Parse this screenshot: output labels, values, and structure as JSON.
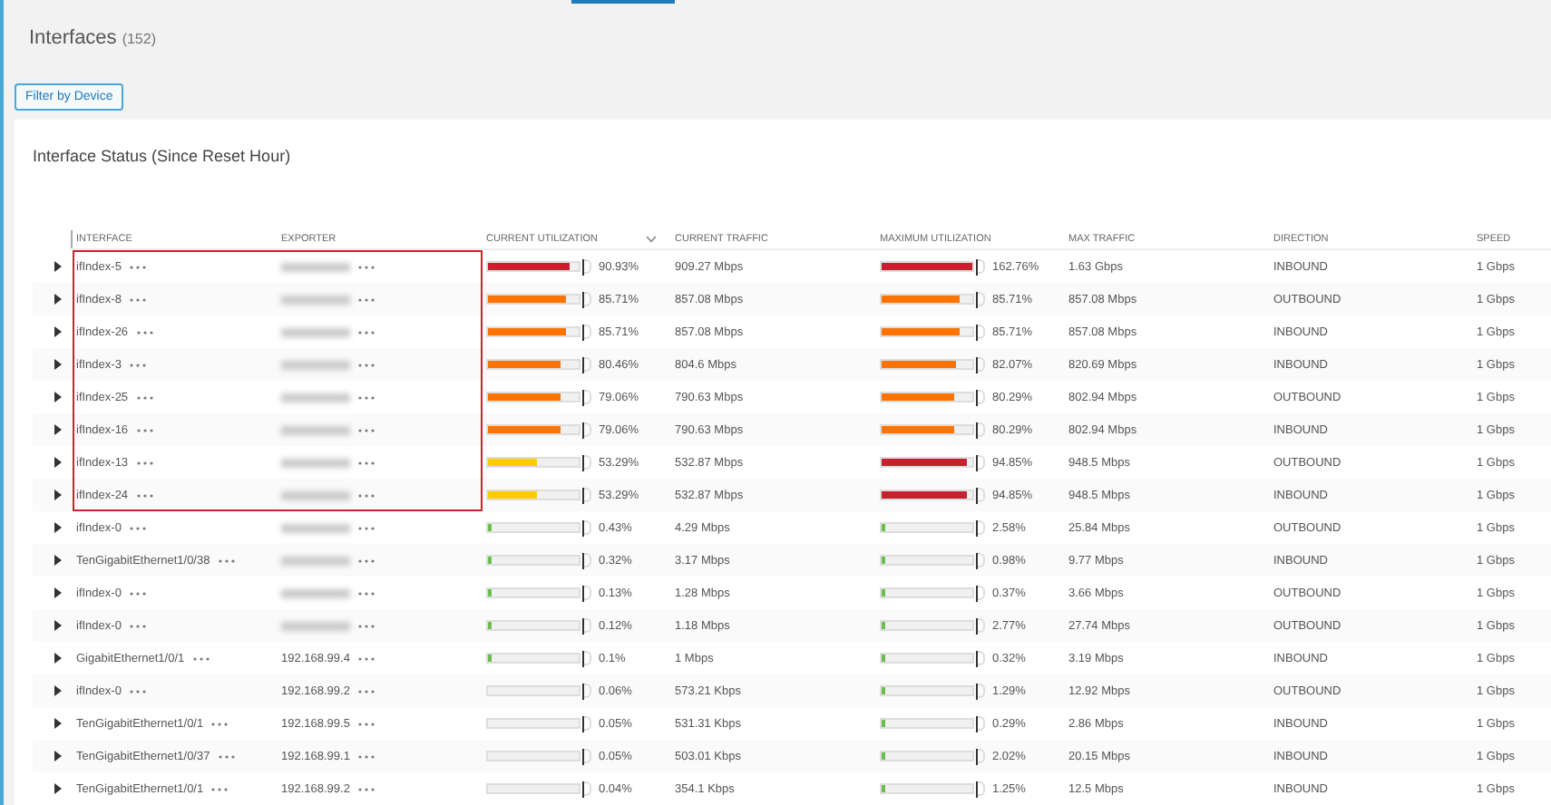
{
  "page": {
    "title": "Interfaces",
    "count": "(152)",
    "filter_button": "Filter by Device"
  },
  "card": {
    "title": "Interface Status (Since Reset Hour)"
  },
  "table": {
    "columns": [
      {
        "label": "INTERFACE",
        "sorted": false
      },
      {
        "label": "EXPORTER",
        "sorted": false
      },
      {
        "label": "CURRENT UTILIZATION",
        "sorted": true
      },
      {
        "label": "CURRENT TRAFFIC",
        "sorted": false
      },
      {
        "label": "MAXIMUM UTILIZATION",
        "sorted": false
      },
      {
        "label": "MAX TRAFFIC",
        "sorted": false
      },
      {
        "label": "DIRECTION",
        "sorted": false
      },
      {
        "label": "SPEED",
        "sorted": false
      }
    ],
    "rows": [
      {
        "interface": "ifIndex-5",
        "exporter_redacted": true,
        "highlighted": true,
        "current_utilization": {
          "text": "90.93%",
          "level": 0.9093,
          "color": "#c8202f"
        },
        "current_traffic": "909.27 Mbps",
        "max_utilization": {
          "text": "162.76%",
          "level": 1,
          "color": "#c8202f"
        },
        "max_traffic": "1.63 Gbps",
        "direction": "INBOUND",
        "speed": "1 Gbps"
      },
      {
        "interface": "ifIndex-8",
        "exporter_redacted": true,
        "highlighted": true,
        "current_utilization": {
          "text": "85.71%",
          "level": 0.8571,
          "color": "#ff7300"
        },
        "current_traffic": "857.08 Mbps",
        "max_utilization": {
          "text": "85.71%",
          "level": 0.8571,
          "color": "#ff7300"
        },
        "max_traffic": "857.08 Mbps",
        "direction": "OUTBOUND",
        "speed": "1 Gbps"
      },
      {
        "interface": "ifIndex-26",
        "exporter_redacted": true,
        "highlighted": true,
        "current_utilization": {
          "text": "85.71%",
          "level": 0.8571,
          "color": "#ff7300"
        },
        "current_traffic": "857.08 Mbps",
        "max_utilization": {
          "text": "85.71%",
          "level": 0.8571,
          "color": "#ff7300"
        },
        "max_traffic": "857.08 Mbps",
        "direction": "INBOUND",
        "speed": "1 Gbps"
      },
      {
        "interface": "ifIndex-3",
        "exporter_redacted": true,
        "highlighted": true,
        "current_utilization": {
          "text": "80.46%",
          "level": 0.8046,
          "color": "#ff7300"
        },
        "current_traffic": "804.6 Mbps",
        "max_utilization": {
          "text": "82.07%",
          "level": 0.8207,
          "color": "#ff7300"
        },
        "max_traffic": "820.69 Mbps",
        "direction": "INBOUND",
        "speed": "1 Gbps"
      },
      {
        "interface": "ifIndex-25",
        "exporter_redacted": true,
        "highlighted": true,
        "current_utilization": {
          "text": "79.06%",
          "level": 0.7906,
          "color": "#ff7300"
        },
        "current_traffic": "790.63 Mbps",
        "max_utilization": {
          "text": "80.29%",
          "level": 0.8029,
          "color": "#ff7300"
        },
        "max_traffic": "802.94 Mbps",
        "direction": "OUTBOUND",
        "speed": "1 Gbps"
      },
      {
        "interface": "ifIndex-16",
        "exporter_redacted": true,
        "highlighted": true,
        "current_utilization": {
          "text": "79.06%",
          "level": 0.7906,
          "color": "#ff7300"
        },
        "current_traffic": "790.63 Mbps",
        "max_utilization": {
          "text": "80.29%",
          "level": 0.8029,
          "color": "#ff7300"
        },
        "max_traffic": "802.94 Mbps",
        "direction": "INBOUND",
        "speed": "1 Gbps"
      },
      {
        "interface": "ifIndex-13",
        "exporter_redacted": true,
        "highlighted": true,
        "current_utilization": {
          "text": "53.29%",
          "level": 0.5329,
          "color": "#ffcc00"
        },
        "current_traffic": "532.87 Mbps",
        "max_utilization": {
          "text": "94.85%",
          "level": 0.9485,
          "color": "#c8202f"
        },
        "max_traffic": "948.5 Mbps",
        "direction": "OUTBOUND",
        "speed": "1 Gbps"
      },
      {
        "interface": "ifIndex-24",
        "exporter_redacted": true,
        "highlighted": true,
        "current_utilization": {
          "text": "53.29%",
          "level": 0.5329,
          "color": "#ffcc00"
        },
        "current_traffic": "532.87 Mbps",
        "max_utilization": {
          "text": "94.85%",
          "level": 0.9485,
          "color": "#c8202f"
        },
        "max_traffic": "948.5 Mbps",
        "direction": "INBOUND",
        "speed": "1 Gbps"
      },
      {
        "interface": "ifIndex-0",
        "exporter_redacted": true,
        "highlighted": false,
        "current_utilization": {
          "text": "0.43%",
          "level": 0.0043,
          "color": "#6abf4b"
        },
        "current_traffic": "4.29 Mbps",
        "max_utilization": {
          "text": "2.58%",
          "level": 0.0258,
          "color": "#6abf4b"
        },
        "max_traffic": "25.84 Mbps",
        "direction": "OUTBOUND",
        "speed": "1 Gbps"
      },
      {
        "interface": "TenGigabitEthernet1/0/38",
        "exporter_redacted": true,
        "highlighted": false,
        "current_utilization": {
          "text": "0.32%",
          "level": 0.0032,
          "color": "#6abf4b"
        },
        "current_traffic": "3.17 Mbps",
        "max_utilization": {
          "text": "0.98%",
          "level": 0.0098,
          "color": "#6abf4b"
        },
        "max_traffic": "9.77 Mbps",
        "direction": "INBOUND",
        "speed": "1 Gbps"
      },
      {
        "interface": "ifIndex-0",
        "exporter_redacted": true,
        "highlighted": false,
        "current_utilization": {
          "text": "0.13%",
          "level": 0.0013,
          "color": "#6abf4b"
        },
        "current_traffic": "1.28 Mbps",
        "max_utilization": {
          "text": "0.37%",
          "level": 0.0037,
          "color": "#6abf4b"
        },
        "max_traffic": "3.66 Mbps",
        "direction": "OUTBOUND",
        "speed": "1 Gbps"
      },
      {
        "interface": "ifIndex-0",
        "exporter_redacted": true,
        "highlighted": false,
        "current_utilization": {
          "text": "0.12%",
          "level": 0.0012,
          "color": "#6abf4b"
        },
        "current_traffic": "1.18 Mbps",
        "max_utilization": {
          "text": "2.77%",
          "level": 0.0277,
          "color": "#6abf4b"
        },
        "max_traffic": "27.74 Mbps",
        "direction": "OUTBOUND",
        "speed": "1 Gbps"
      },
      {
        "interface": "GigabitEthernet1/0/1",
        "exporter": "192.168.99.4",
        "exporter_redacted": false,
        "highlighted": false,
        "current_utilization": {
          "text": "0.1%",
          "level": 0.001,
          "color": "#6abf4b"
        },
        "current_traffic": "1 Mbps",
        "max_utilization": {
          "text": "0.32%",
          "level": 0.0032,
          "color": "#6abf4b"
        },
        "max_traffic": "3.19 Mbps",
        "direction": "INBOUND",
        "speed": "1 Gbps"
      },
      {
        "interface": "ifIndex-0",
        "exporter": "192.168.99.2",
        "exporter_redacted": false,
        "highlighted": false,
        "current_utilization": {
          "text": "0.06%",
          "level": 0.0006
        },
        "current_traffic": "573.21 Kbps",
        "max_utilization": {
          "text": "1.29%",
          "level": 0.0129,
          "color": "#6abf4b"
        },
        "max_traffic": "12.92 Mbps",
        "direction": "OUTBOUND",
        "speed": "1 Gbps"
      },
      {
        "interface": "TenGigabitEthernet1/0/1",
        "exporter": "192.168.99.5",
        "exporter_redacted": false,
        "highlighted": false,
        "current_utilization": {
          "text": "0.05%",
          "level": 0.0005
        },
        "current_traffic": "531.31 Kbps",
        "max_utilization": {
          "text": "0.29%",
          "level": 0.0029,
          "color": "#6abf4b"
        },
        "max_traffic": "2.86 Mbps",
        "direction": "INBOUND",
        "speed": "1 Gbps"
      },
      {
        "interface": "TenGigabitEthernet1/0/37",
        "exporter": "192.168.99.1",
        "exporter_redacted": false,
        "highlighted": false,
        "current_utilization": {
          "text": "0.05%",
          "level": 0.0005
        },
        "current_traffic": "503.01 Kbps",
        "max_utilization": {
          "text": "2.02%",
          "level": 0.0202,
          "color": "#6abf4b"
        },
        "max_traffic": "20.15 Mbps",
        "direction": "INBOUND",
        "speed": "1 Gbps"
      },
      {
        "interface": "TenGigabitEthernet1/0/1",
        "exporter": "192.168.99.2",
        "exporter_redacted": false,
        "highlighted": false,
        "current_utilization": {
          "text": "0.04%",
          "level": 0.0004
        },
        "current_traffic": "354.1 Kbps",
        "max_utilization": {
          "text": "1.25%",
          "level": 0.0125,
          "color": "#6abf4b"
        },
        "max_traffic": "12.5 Mbps",
        "direction": "INBOUND",
        "speed": "1 Gbps"
      }
    ]
  }
}
